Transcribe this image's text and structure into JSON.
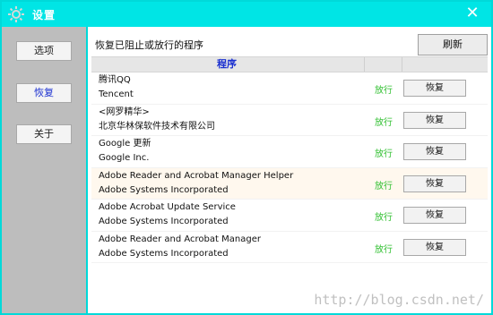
{
  "window": {
    "title": "设置",
    "close_glyph": "✕",
    "accent": "#00e5e5"
  },
  "sidebar": {
    "items": [
      {
        "label": "选项"
      },
      {
        "label": "恢复"
      },
      {
        "label": "关于"
      }
    ],
    "active_index": 1
  },
  "content": {
    "heading": "恢复已阻止或放行的程序",
    "refresh_label": "刷新",
    "column_header": "程序",
    "status_color": "#2fbf2f",
    "rows": [
      {
        "name": "腾讯QQ",
        "publisher": "Tencent",
        "status": "放行",
        "action": "恢复"
      },
      {
        "name": "<网罗精华>",
        "publisher": "北京华林保软件技术有限公司",
        "status": "放行",
        "action": "恢复"
      },
      {
        "name": "Google 更新",
        "publisher": "Google Inc.",
        "status": "放行",
        "action": "恢复"
      },
      {
        "name": "Adobe Reader and Acrobat Manager Helper",
        "publisher": "Adobe Systems Incorporated",
        "status": "放行",
        "action": "恢复"
      },
      {
        "name": "Adobe Acrobat Update Service",
        "publisher": "Adobe Systems Incorporated",
        "status": "放行",
        "action": "恢复"
      },
      {
        "name": "Adobe Reader and Acrobat Manager",
        "publisher": "Adobe Systems Incorporated",
        "status": "放行",
        "action": "恢复"
      }
    ]
  },
  "watermark": "http://blog.csdn.net/"
}
